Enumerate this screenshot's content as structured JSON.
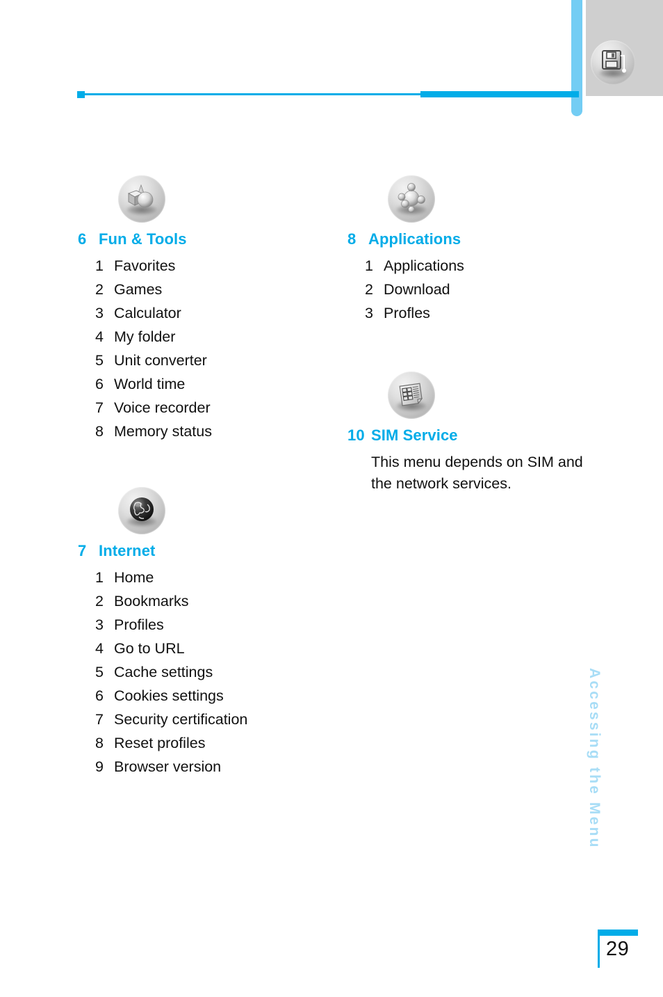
{
  "page": {
    "number": "29",
    "side_tab_label": "Accessing the Menu",
    "accent_color": "#00ace8",
    "side_tab_color": "#a8ddf6",
    "header_panel_color": "#cfcfcf"
  },
  "header": {
    "icon": "save-disk-icon"
  },
  "sections": [
    {
      "id": "fun-and-tools",
      "icon": "3d-shapes-icon",
      "number": "6",
      "title": "Fun & Tools",
      "items": [
        {
          "number": "1",
          "label": "Favorites"
        },
        {
          "number": "2",
          "label": "Games"
        },
        {
          "number": "3",
          "label": "Calculator"
        },
        {
          "number": "4",
          "label": "My folder"
        },
        {
          "number": "5",
          "label": "Unit converter"
        },
        {
          "number": "6",
          "label": "World time"
        },
        {
          "number": "7",
          "label": "Voice recorder"
        },
        {
          "number": "8",
          "label": "Memory status"
        }
      ]
    },
    {
      "id": "internet",
      "icon": "globe-icon",
      "number": "7",
      "title": "Internet",
      "items": [
        {
          "number": "1",
          "label": "Home"
        },
        {
          "number": "2",
          "label": "Bookmarks"
        },
        {
          "number": "3",
          "label": "Profiles"
        },
        {
          "number": "4",
          "label": "Go to URL"
        },
        {
          "number": "5",
          "label": "Cache settings"
        },
        {
          "number": "6",
          "label": "Cookies settings"
        },
        {
          "number": "7",
          "label": "Security certification"
        },
        {
          "number": "8",
          "label": "Reset profiles"
        },
        {
          "number": "9",
          "label": "Browser version"
        }
      ]
    },
    {
      "id": "applications",
      "icon": "molecule-icon",
      "number": "8",
      "title": "Applications",
      "items": [
        {
          "number": "1",
          "label": "Applications"
        },
        {
          "number": "2",
          "label": "Download"
        },
        {
          "number": "3",
          "label": "Profles"
        }
      ]
    },
    {
      "id": "sim-service",
      "icon": "sim-card-icon",
      "number": "10",
      "title": "SIM Service",
      "note": "This menu depends on SIM and the network services."
    }
  ]
}
